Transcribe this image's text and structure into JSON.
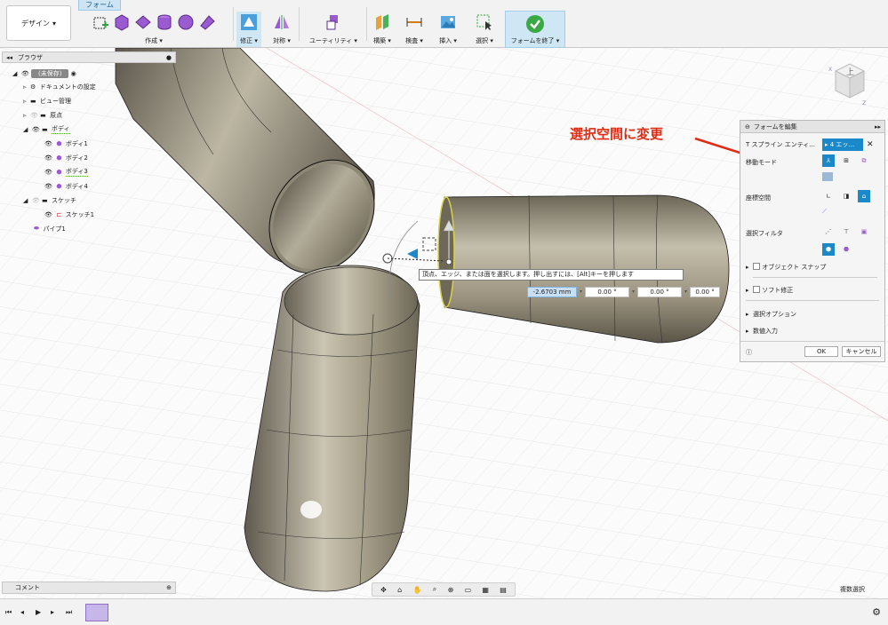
{
  "toolbar": {
    "workspace_label": "デザイン",
    "active_tab": "フォーム",
    "groups": [
      {
        "label": "作成"
      },
      {
        "label": "修正"
      },
      {
        "label": "対称"
      },
      {
        "label": "ユーティリティ"
      },
      {
        "label": "構築"
      },
      {
        "label": "検査"
      },
      {
        "label": "挿入"
      },
      {
        "label": "選択"
      }
    ],
    "finish_label": "フォームを終了"
  },
  "browser": {
    "title": "ブラウザ",
    "items": [
      {
        "label": "(未保存)"
      },
      {
        "label": "ドキュメントの設定"
      },
      {
        "label": "ビュー管理"
      },
      {
        "label": "原点"
      },
      {
        "label": "ボディ"
      },
      {
        "label": "ボディ1"
      },
      {
        "label": "ボディ2"
      },
      {
        "label": "ボディ3"
      },
      {
        "label": "ボディ4"
      },
      {
        "label": "スケッチ"
      },
      {
        "label": "スケッチ1"
      },
      {
        "label": "パイプ1"
      }
    ]
  },
  "comment_label": "コメント",
  "status": {
    "multi_select": "複数選択"
  },
  "panel": {
    "title": "フォームを編集",
    "dropdown1": "T スプライン エンティ...",
    "dropdown2": "4 エッ...",
    "move_mode_label": "移動モード",
    "coord_space_label": "座標空間",
    "select_filter_label": "選択フィルタ",
    "object_snap_label": "オブジェクト スナップ",
    "soft_modify_label": "ソフト修正",
    "select_options_label": "選択オプション",
    "numeric_input_label": "数値入力",
    "ok_label": "OK",
    "cancel_label": "キャンセル"
  },
  "callout": {
    "text": "選択空間に変更",
    "color": "#e12c13"
  },
  "viewport": {
    "tooltip": "頂点、エッジ、または面を選択します。押し出すには、[Alt]キーを押します",
    "inputs": {
      "distance": "-2.6703 mm",
      "angle1": "0.00 °",
      "angle2": "0.00 °",
      "angle3": "0.00 °"
    }
  },
  "viewcube": {
    "label": "上"
  },
  "colors": {
    "accent": "#1a88c9",
    "panel_bg": "#f5f5f5"
  }
}
